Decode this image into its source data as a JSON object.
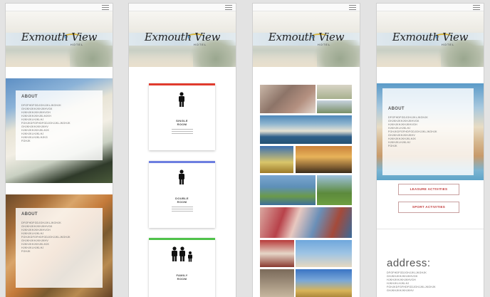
{
  "header": {
    "logo_text": "Exmouth View",
    "logo_sub": "HOTEL"
  },
  "screen1": {
    "about1": {
      "title": "ABOUT",
      "lines": [
        "DFGFHDFGDJGHJJKLJKGHJK",
        "GHJKHJKHJKHJKHVGK",
        "HJKHJKHJKHJKHVGH",
        "HJKHJKHJKHJKLHJKH",
        "HJKHJKLHJKLHJ",
        "FGHJKDFGFHDFGDJGHJJKLJKGHJK",
        "GHJKHJKHJKHJKHV",
        "HJKHJKHJKHJKLHJK",
        "HJKHJKLHJKLHJ",
        "HJKHJKLHJKLHJKG",
        "FGHJK"
      ]
    },
    "about2": {
      "title": "ABOUT",
      "lines": [
        "DFGFHDFGDJGHJJKLJKGHJK",
        "GHJKHJKHJKHJKHVGK",
        "HJKHJKHJKHJKHVGH",
        "HJKHJKLHJKLHJ",
        "FGHJKDFGFHDFGDJGHJJKLJKGHJK",
        "GHJKHJKHJKHJKHV",
        "HJKHJKHJKHJKLHJK",
        "HJKHJKLHJKLHJ",
        "FGHJK"
      ]
    }
  },
  "screen2": {
    "rooms": [
      {
        "label1": "SINGLE",
        "label2": "ROOM",
        "color": "#e03b2e"
      },
      {
        "label1": "DOUBLE",
        "label2": "ROOM",
        "color": "#6d7ee0"
      },
      {
        "label1": "FAMILY",
        "label2": "ROOM",
        "color": "#4fc24a"
      }
    ]
  },
  "screen4": {
    "about": {
      "title": "ABOUT",
      "lines": [
        "DFGFHDFGDJGHJJKLJKGHJK",
        "GHJKHJKHJKHJKHVGK",
        "HJKHJKHJKHJKHVGH",
        "HJKHJKLHJKLHJ",
        "FGHJKDFGFHDFGDJGHJJKLJKGHJK",
        "GHJKHJKHJKHJKHV",
        "HJKHJKHJKHJKLHJK",
        "HJKHJKLHJKLHJ",
        "FGHJK"
      ]
    },
    "buttons": {
      "leisure": "LEASURE ACTIVITIES",
      "sport": "SPORT ACTIVITIES"
    },
    "address_title": "address:",
    "address_lines": [
      "DFGFHDFGDJGHJJKLJKGHJK",
      "GHJKHJKHJKHJKHVGK",
      "HJKHJKHJKHJKHVGH",
      "HJKHJKLHJKLHJ",
      "FGHJKDFGFHDFGDJGHJJKLJKGHJK",
      "GHJKHJKHJKHJKHV"
    ]
  },
  "colors": {
    "accent_red": "#c23b3b",
    "background": "#e3e3e3"
  }
}
